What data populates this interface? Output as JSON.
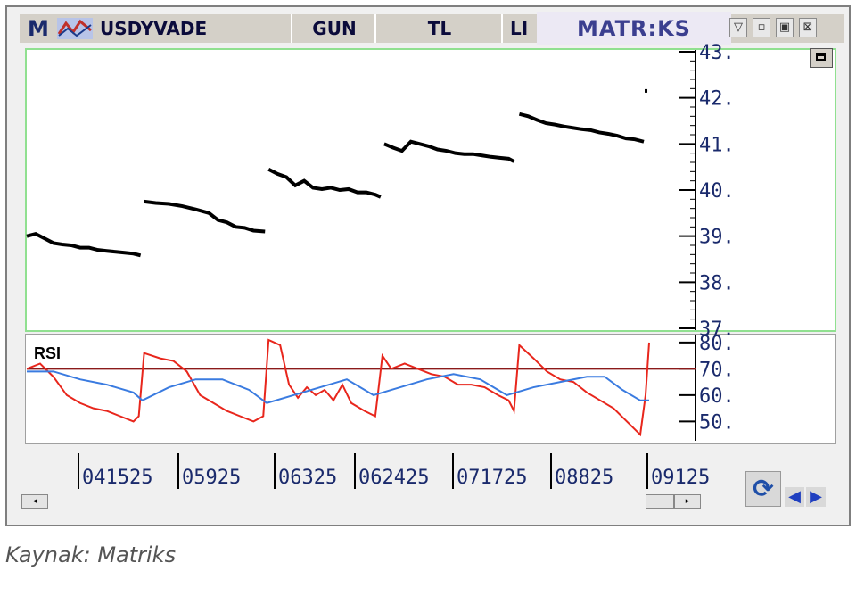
{
  "titlebar": {
    "logo": "M",
    "symbol": "USDYVADE",
    "period": "GUN",
    "currency": "TL",
    "extra": "LI",
    "brand": "MATR:KS",
    "buttons": [
      "▽",
      "▫",
      "▣",
      "⊠"
    ]
  },
  "source_caption": "Kaynak: Matriks",
  "colors": {
    "price": "#000000",
    "rsi": "#e8261c",
    "rsi_signal": "#3a7be0",
    "rsi_level": "#8b1a1a",
    "price_border": "#90e090"
  },
  "chart_data": [
    {
      "type": "line",
      "title": "USDYVADE",
      "price_ticks": [
        "43.",
        "42.",
        "41.",
        "40.",
        "39.",
        "38.",
        "37."
      ],
      "ylim": [
        37,
        43
      ],
      "segments": [
        {
          "x": [
            0,
            10,
            20,
            30,
            40,
            50,
            60,
            70,
            80,
            90,
            100,
            110,
            120,
            128
          ],
          "y": [
            39.0,
            39.05,
            38.95,
            38.85,
            38.82,
            38.8,
            38.75,
            38.75,
            38.7,
            38.68,
            38.66,
            38.64,
            38.62,
            38.58
          ]
        },
        {
          "x": [
            132,
            145,
            160,
            175,
            190,
            205,
            215,
            225,
            235,
            245,
            255,
            268
          ],
          "y": [
            39.75,
            39.72,
            39.7,
            39.65,
            39.58,
            39.5,
            39.35,
            39.3,
            39.2,
            39.18,
            39.12,
            39.1
          ]
        },
        {
          "x": [
            272,
            282,
            292,
            302,
            312,
            322,
            332,
            342,
            352,
            362,
            372,
            382,
            392,
            398
          ],
          "y": [
            40.45,
            40.35,
            40.28,
            40.1,
            40.2,
            40.05,
            40.02,
            40.05,
            40.0,
            40.02,
            39.95,
            39.95,
            39.9,
            39.85
          ]
        },
        {
          "x": [
            402,
            412,
            422,
            432,
            442,
            452,
            462,
            472,
            482,
            492,
            502,
            512,
            522,
            532,
            542,
            548
          ],
          "y": [
            41.0,
            40.92,
            40.85,
            41.05,
            41.0,
            40.95,
            40.88,
            40.85,
            40.8,
            40.78,
            40.78,
            40.75,
            40.72,
            40.7,
            40.68,
            40.62
          ]
        },
        {
          "x": [
            554,
            564,
            574,
            584,
            594,
            604,
            614,
            624,
            634,
            644,
            654,
            664,
            674,
            684,
            694
          ],
          "y": [
            41.65,
            41.6,
            41.52,
            41.45,
            41.42,
            41.38,
            41.35,
            41.32,
            41.3,
            41.25,
            41.22,
            41.18,
            41.12,
            41.1,
            41.05
          ]
        },
        {
          "x": [
            696
          ],
          "y": [
            42.15
          ]
        }
      ]
    },
    {
      "type": "line",
      "title": "RSI",
      "rsi_ticks": [
        "80.",
        "70.",
        "60.",
        "50."
      ],
      "ylim": [
        42,
        82
      ],
      "level": 70,
      "series": [
        {
          "key": "rsi",
          "values": [
            [
              0,
              70
            ],
            [
              15,
              72
            ],
            [
              30,
              67
            ],
            [
              45,
              60
            ],
            [
              60,
              57
            ],
            [
              75,
              55
            ],
            [
              90,
              54
            ],
            [
              105,
              52
            ],
            [
              120,
              50
            ],
            [
              126,
              52
            ],
            [
              132,
              76
            ],
            [
              150,
              74
            ],
            [
              165,
              73
            ],
            [
              180,
              69
            ],
            [
              195,
              60
            ],
            [
              210,
              57
            ],
            [
              225,
              54
            ],
            [
              240,
              52
            ],
            [
              255,
              50
            ],
            [
              266,
              52
            ],
            [
              272,
              81
            ],
            [
              285,
              79
            ],
            [
              295,
              64
            ],
            [
              305,
              59
            ],
            [
              315,
              63
            ],
            [
              325,
              60
            ],
            [
              335,
              62
            ],
            [
              345,
              58
            ],
            [
              355,
              64
            ],
            [
              365,
              57
            ],
            [
              380,
              54
            ],
            [
              392,
              52
            ],
            [
              400,
              75
            ],
            [
              410,
              70
            ],
            [
              425,
              72
            ],
            [
              440,
              70
            ],
            [
              455,
              68
            ],
            [
              470,
              67
            ],
            [
              485,
              64
            ],
            [
              500,
              64
            ],
            [
              515,
              63
            ],
            [
              530,
              60
            ],
            [
              542,
              58
            ],
            [
              548,
              54
            ],
            [
              554,
              79
            ],
            [
              570,
              74
            ],
            [
              585,
              69
            ],
            [
              600,
              66
            ],
            [
              615,
              65
            ],
            [
              630,
              61
            ],
            [
              645,
              58
            ],
            [
              660,
              55
            ],
            [
              675,
              50
            ],
            [
              690,
              45
            ],
            [
              696,
              60
            ],
            [
              700,
              80
            ]
          ]
        },
        {
          "key": "rsi_signal",
          "values": [
            [
              0,
              69
            ],
            [
              30,
              69
            ],
            [
              60,
              66
            ],
            [
              90,
              64
            ],
            [
              120,
              61
            ],
            [
              130,
              58
            ],
            [
              160,
              63
            ],
            [
              190,
              66
            ],
            [
              220,
              66
            ],
            [
              250,
              62
            ],
            [
              270,
              57
            ],
            [
              300,
              60
            ],
            [
              330,
              63
            ],
            [
              360,
              66
            ],
            [
              390,
              60
            ],
            [
              420,
              63
            ],
            [
              450,
              66
            ],
            [
              480,
              68
            ],
            [
              510,
              66
            ],
            [
              540,
              60
            ],
            [
              570,
              63
            ],
            [
              600,
              65
            ],
            [
              630,
              67
            ],
            [
              650,
              67
            ],
            [
              670,
              62
            ],
            [
              690,
              58
            ],
            [
              700,
              58
            ]
          ]
        }
      ]
    }
  ],
  "x_ticks": [
    "041525",
    "05925",
    "06325",
    "062425",
    "071725",
    "08825",
    "09125"
  ],
  "rsi_label": "RSI",
  "controls": {
    "scroll_left": "◂",
    "scroll_right": "▸",
    "refresh_icon": "⟳",
    "nav_left": "◀",
    "nav_right": "▶"
  }
}
